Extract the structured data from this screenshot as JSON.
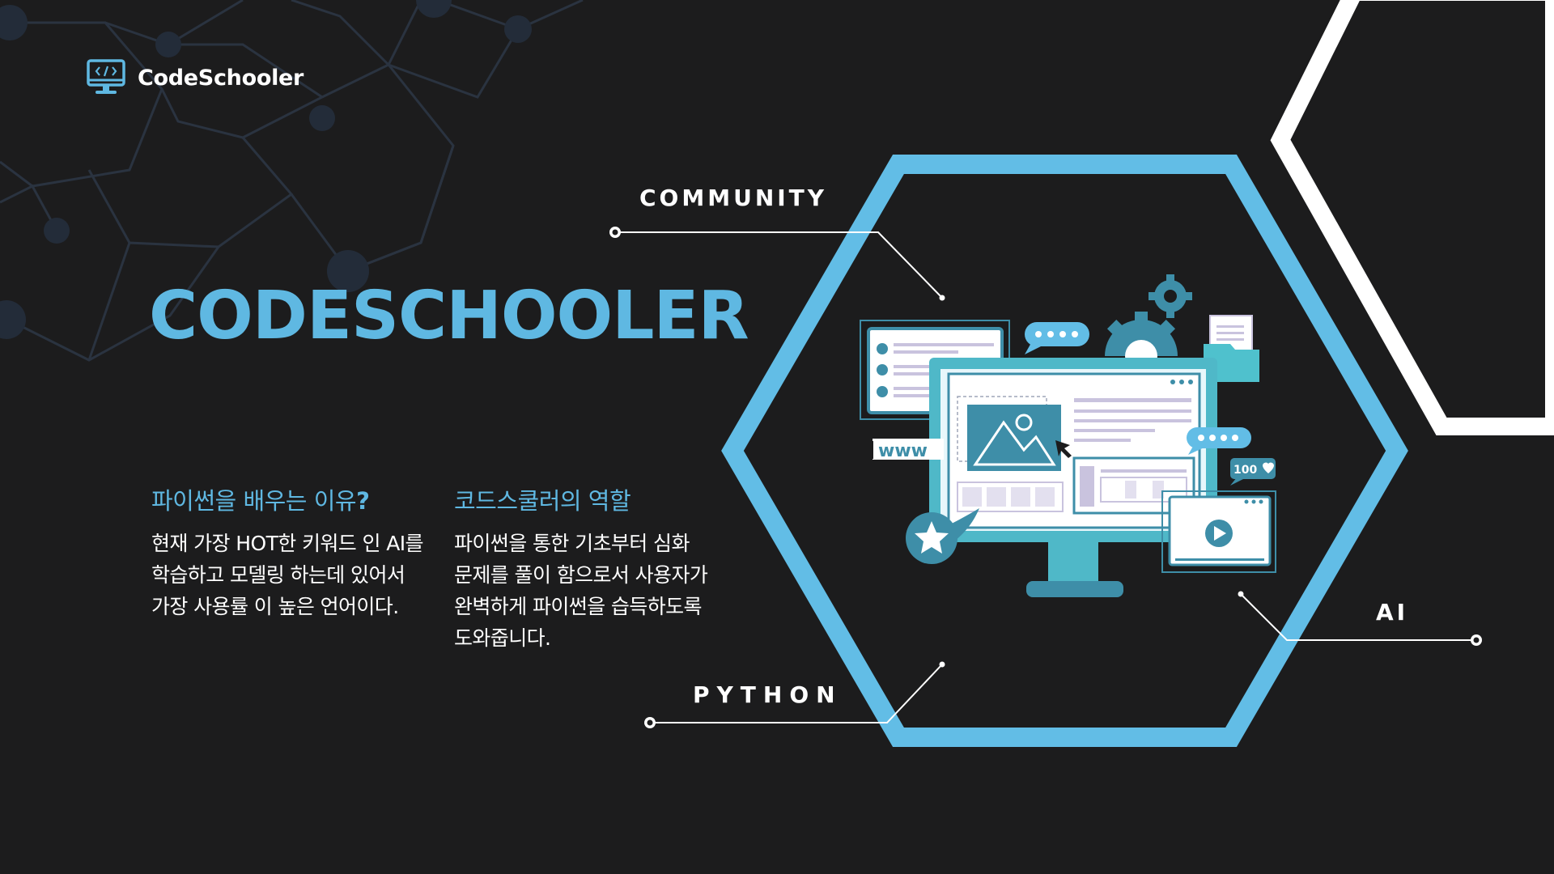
{
  "brand": {
    "name": "CodeSchooler",
    "icon": "monitor-code-icon"
  },
  "hero": {
    "title": "CODESCHOOLER"
  },
  "sections": [
    {
      "heading": "파이썬을 배우는 이유",
      "heading_mark": "?",
      "body": "현재 가장 HOT한 키워드 인 AI를 학습하고 모델링 하는데 있어서 가장 사용률 이 높은 언어이다."
    },
    {
      "heading": "코드스쿨러의 역할",
      "body": "파이썬을 통한 기초부터 심화 문제를 풀이 함으로서 사용자가 완벽하게 파이썬을 습득하도록 도와줍니다."
    }
  ],
  "callouts": {
    "community": "COMMUNITY",
    "python": "PYTHON",
    "ai": "AI"
  },
  "illustration": {
    "url_tag": "www",
    "likes_badge": "100"
  },
  "colors": {
    "background": "#1c1c1d",
    "accent_blue": "#5fb8e2",
    "hex_frame": "#62bde6",
    "teal": "#3e8ea8",
    "text": "#ffffff"
  }
}
